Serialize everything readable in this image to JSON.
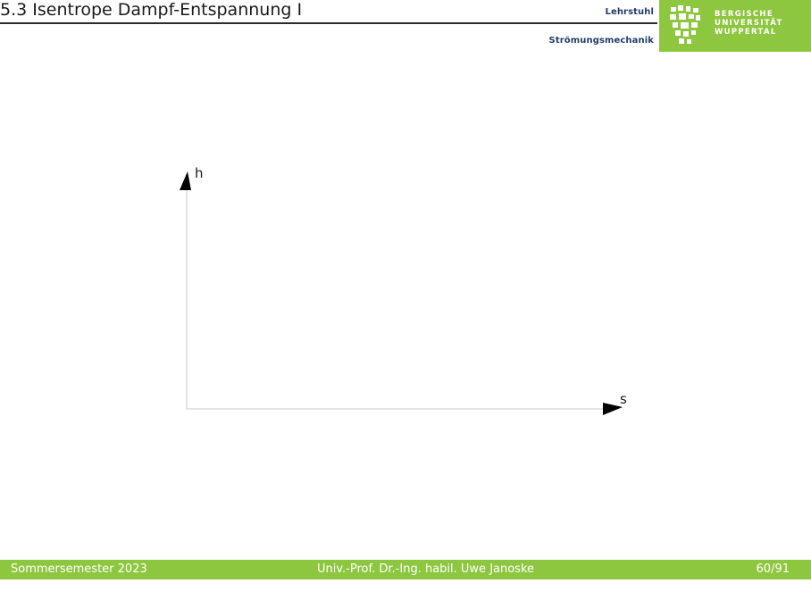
{
  "header": {
    "title": "5.3 Isentrope Dampf-Entspannung I",
    "chair_line1": "Lehrstuhl",
    "chair_line2": "Strömungsmechanik",
    "logo_lines": [
      "BERGISCHE",
      "UNIVERSITÄT",
      "WUPPERTAL"
    ]
  },
  "diagram": {
    "y_axis_label": "h",
    "x_axis_label": "s"
  },
  "footer": {
    "left": "Sommersemester 2023",
    "center": "Univ.-Prof. Dr.-Ing. habil. Uwe Janoske",
    "right": "60/91"
  },
  "colors": {
    "accent_green": "#8dc63f",
    "chair_blue": "#1f3d6b",
    "axis_gray": "#c8c8c8"
  }
}
